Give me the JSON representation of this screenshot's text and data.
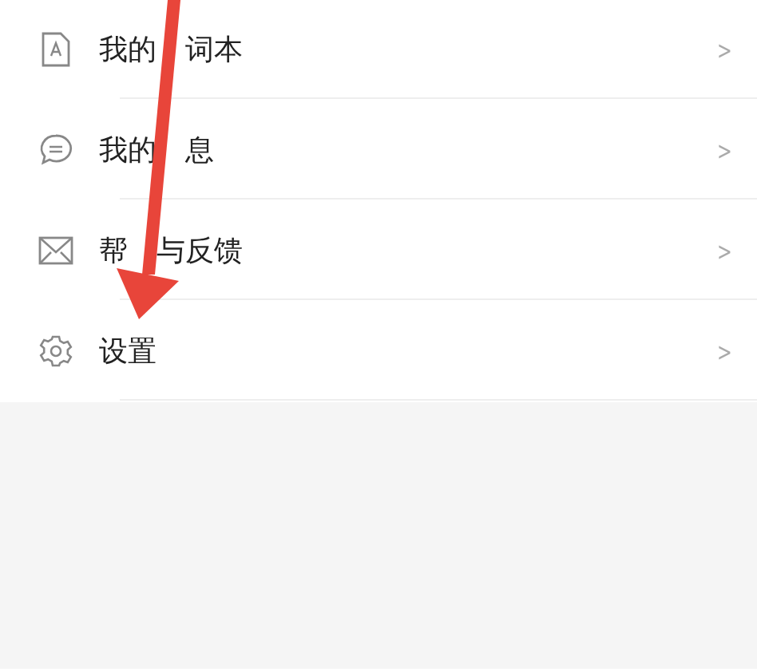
{
  "menu": [
    {
      "kind": "wordbook",
      "label_parts": [
        "我的",
        "词本"
      ],
      "chevron": ">"
    },
    {
      "kind": "message",
      "label_parts": [
        "我的",
        "息"
      ],
      "chevron": ">"
    },
    {
      "kind": "mail",
      "label_parts": [
        "帮",
        "与反馈"
      ],
      "chevron": ">"
    },
    {
      "kind": "gear",
      "label_parts": [
        "设置"
      ],
      "chevron": ">"
    }
  ]
}
